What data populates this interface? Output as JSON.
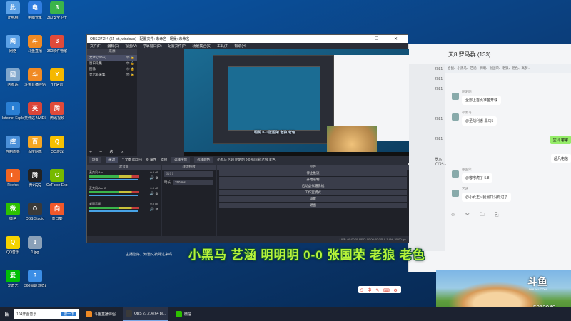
{
  "desktop_icons": [
    {
      "label": "此电脑",
      "icon": "computer-icon",
      "color": "#5aa0e6"
    },
    {
      "label": "电脑管家",
      "icon": "shield-icon",
      "color": "#2f7de0"
    },
    {
      "label": "360安全卫士",
      "icon": "plus-shield-icon",
      "color": "#3bb44a"
    },
    {
      "label": "网络",
      "icon": "network-icon",
      "color": "#5aa0e6"
    },
    {
      "label": "斗鱼直播",
      "icon": "douyu-icon",
      "color": "#f08a24"
    },
    {
      "label": "360软件管家",
      "icon": "app-store-icon",
      "color": "#e04a3a"
    },
    {
      "label": "回收站",
      "icon": "recycle-bin-icon",
      "color": "#7fa6cc"
    },
    {
      "label": "斗鱼直播伴侣",
      "icon": "douyu-icon",
      "color": "#f08a24"
    },
    {
      "label": "YY语音",
      "icon": "yy-icon",
      "color": "#f5b800"
    },
    {
      "label": "Internet Explorer",
      "icon": "ie-icon",
      "color": "#2a7fd4"
    },
    {
      "label": "英伟达 NVIDIA",
      "icon": "driver-icon",
      "color": "#d9453a"
    },
    {
      "label": "腾讯视频",
      "icon": "video-icon",
      "color": "#e04a3a"
    },
    {
      "label": "控制面板",
      "icon": "control-panel-icon",
      "color": "#4a8fd8"
    },
    {
      "label": "百度网盘",
      "icon": "cloud-icon",
      "color": "#f5a623"
    },
    {
      "label": "QQ游戏",
      "icon": "game-icon",
      "color": "#f5c000"
    },
    {
      "label": "Firefox",
      "icon": "firefox-icon",
      "color": "#f26522"
    },
    {
      "label": "腾讯QQ",
      "icon": "qq-icon",
      "color": "#222222"
    },
    {
      "label": "GeForce Experience",
      "icon": "nvidia-icon",
      "color": "#76b900"
    },
    {
      "label": "微信",
      "icon": "wechat-icon",
      "color": "#2dc100"
    },
    {
      "label": "OBS Studio",
      "icon": "obs-icon",
      "color": "#3a3a3a"
    },
    {
      "label": "向日葵",
      "icon": "sunflower-icon",
      "color": "#f0582a"
    },
    {
      "label": "QQ音乐",
      "icon": "music-icon",
      "color": "#f5d300"
    },
    {
      "label": "1.jpg",
      "icon": "image-file-icon",
      "color": "#8aa0b8"
    },
    {
      "label": "爱奇艺",
      "icon": "iqiyi-icon",
      "color": "#00be06"
    },
    {
      "label": "360极速浏览器",
      "icon": "browser-icon",
      "color": "#3b8ee6"
    }
  ],
  "obs": {
    "title": "OBS 27.2.4 (64-bit, windows) - 配置文件: 未命名 - 场景: 未命名",
    "menu": [
      "文件(F)",
      "编辑(E)",
      "视图(V)",
      "停靠窗口(D)",
      "配置文件(P)",
      "场景集合(S)",
      "工具(T)",
      "帮助(H)"
    ],
    "sources_header": "来源",
    "sources": [
      {
        "label": "文本 (GDI+)",
        "selected": true
      },
      {
        "label": "窗口采集",
        "selected": false
      },
      {
        "label": "图像",
        "selected": false
      },
      {
        "label": "显示器采集",
        "selected": false
      }
    ],
    "source_tools": "+ − ⚙ ∧ ∨",
    "preview_text": "明明 0-0 张国荣 老狼 老色",
    "tabs": [
      "场景",
      "来源",
      "T 文本 (GDI+)",
      "⚙ 属性",
      "滤镜",
      "选择字体",
      "选择颜色"
    ],
    "marquee": "小黑马 艺涵 明明明 0-0 张国荣 老狼 老色",
    "mixer_header": "混音器",
    "mixer": [
      {
        "name": "麦克风/Aux",
        "level": "0.0 dB",
        "fill": 0.62
      },
      {
        "name": "麦克风/Aux 2",
        "level": "0.0 dB",
        "fill": 0.62
      },
      {
        "name": "桌面音频",
        "level": "0.0 dB",
        "fill": 0.62
      }
    ],
    "transitions_header": "转场特效",
    "transition": "淡出",
    "duration_label": "时长",
    "duration": "250 ms",
    "controls_header": "控件",
    "controls": [
      "停止推流",
      "开始录制",
      "启动虚拟摄像机",
      "工作室模式",
      "设置",
      "退出"
    ],
    "status": "LIVE: 00:00:00   REC: 00:00:00   CPU: 1.4%, 30.00 fps"
  },
  "chat": {
    "title": "天8 罗马群 (133)",
    "bar_text": "仓鼠、小黑马、艺涵、明明、张国荣、老狼、老色、高梦...",
    "messages": [
      {
        "nick": "明明明",
        "text": "全部上首页准备开球"
      },
      {
        "nick": "小黑马",
        "text": "@圣战利者 黑马5"
      },
      {
        "nick": "张国荣",
        "text": "@嘟嘟虎子 5.8"
      },
      {
        "nick": "艺涵",
        "text": "@小女王~ 我最口没有过了"
      }
    ],
    "right_bubbles": [
      "宝贝 嘟嘟",
      "超凡电信"
    ],
    "strip": [
      "2021",
      "2021",
      "2021",
      "",
      "",
      "2021",
      "",
      "2021",
      "",
      "罗马YY14...",
      ""
    ],
    "toolbar": "☺ ✂ 🗀 ⎘"
  },
  "overlay": {
    "text": "小黑马 艺涵 明明明 0-0 张国荣 老狼 老色",
    "notice": "主播您好，知道又被骂过来吗",
    "sogou": "S 中 ✎ ⌨ ⚙"
  },
  "stream": {
    "logo": "斗鱼",
    "site": "DOUYU.COM",
    "room_id": "5913940"
  },
  "taskbar": {
    "search_placeholder": "104开图音乐",
    "search_button": "搜一下",
    "items": [
      {
        "label": "斗鱼直播伴侣",
        "color": "#f08a24",
        "active": false
      },
      {
        "label": "OBS 27.2.4 (64 bi...",
        "color": "#3a3a3a",
        "active": true
      },
      {
        "label": "微信",
        "color": "#2dc100",
        "active": false
      }
    ]
  }
}
